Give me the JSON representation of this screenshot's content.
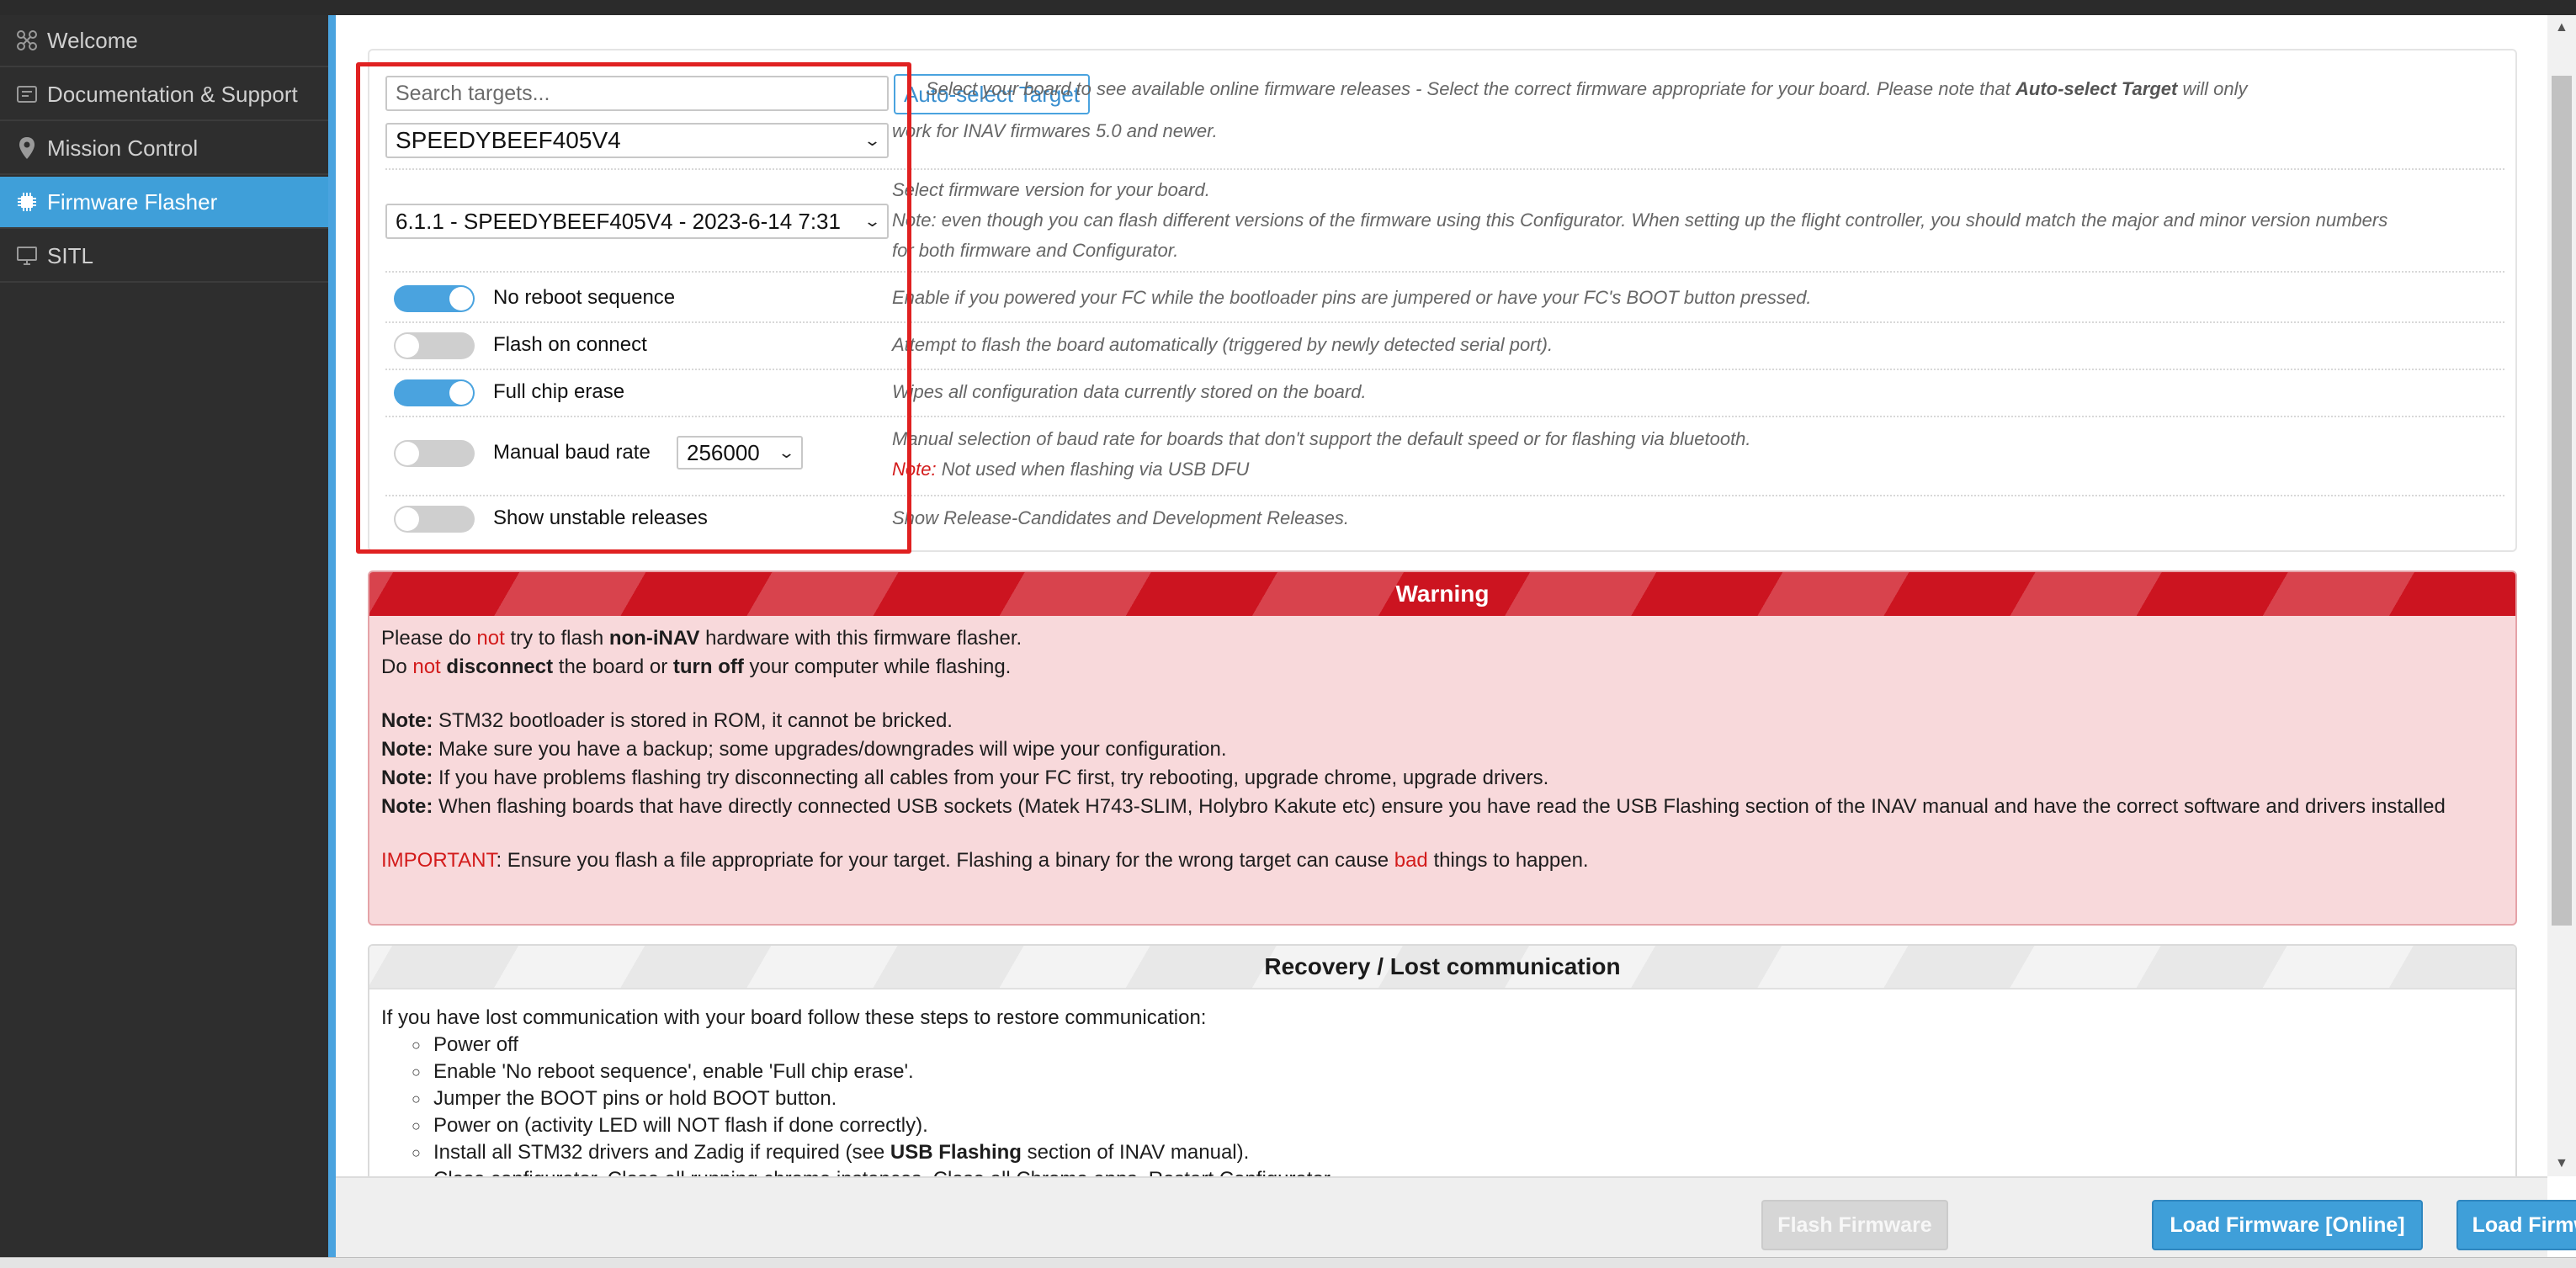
{
  "sidebar": {
    "items": [
      {
        "label": "Welcome",
        "icon": "welcome-icon"
      },
      {
        "label": "Documentation & Support",
        "icon": "support-icon"
      },
      {
        "label": "Mission Control",
        "icon": "map-pin-icon"
      },
      {
        "label": "Firmware Flasher",
        "icon": "chip-icon",
        "active": true
      },
      {
        "label": "SITL",
        "icon": "monitor-icon"
      }
    ]
  },
  "options": {
    "search_placeholder": "Search targets...",
    "autoselect_label": "Auto-select Target",
    "board_value": "SPEEDYBEEF405V4",
    "version_value": "6.1.1 - SPEEDYBEEF405V4 - 2023-6-14 7:31",
    "board_desc_1": "Select your board to see available online firmware releases - Select the correct firmware appropriate for your board. Please note that",
    "board_desc_bold": "Auto-select Target",
    "board_desc_2": "will only",
    "board_desc_line2": "work for INAV firmwares 5.0 and newer.",
    "version_desc_1": "Select firmware version for your board.",
    "version_desc_2": "Note: even though you can flash different versions of the firmware using this Configurator. When setting up the flight controller, you should match the major and minor version numbers",
    "version_desc_3": "for both firmware and Configurator.",
    "no_reboot_label": "No reboot sequence",
    "no_reboot_desc": "Enable if you powered your FC while the bootloader pins are jumpered or have your FC's BOOT button pressed.",
    "flash_connect_label": "Flash on connect",
    "flash_connect_desc": "Attempt to flash the board automatically (triggered by newly detected serial port).",
    "full_erase_label": "Full chip erase",
    "full_erase_desc": "Wipes all configuration data currently stored on the board.",
    "baud_label": "Manual baud rate",
    "baud_value": "256000",
    "baud_desc_1": "Manual selection of baud rate for boards that don't support the default speed or for flashing via bluetooth.",
    "baud_note_prefix": "Note:",
    "baud_note": "Not used when flashing via USB DFU",
    "unstable_label": "Show unstable releases",
    "unstable_desc": "Show Release-Candidates and Development Releases.",
    "toggles": {
      "no_reboot": true,
      "flash_connect": false,
      "full_erase": true,
      "baud": false,
      "unstable": false
    }
  },
  "warning": {
    "title": "Warning",
    "l1_a": "Please do",
    "l1_red": "not",
    "l1_b": "try to flash",
    "l1_bold": "non-iNAV",
    "l1_c": "hardware with this firmware flasher.",
    "l2_a": "Do",
    "l2_red": "not",
    "l2_bold1": "disconnect",
    "l2_b": "the board or",
    "l2_bold2": "turn off",
    "l2_c": "your computer while flashing.",
    "note_label": "Note:",
    "note1": "STM32 bootloader is stored in ROM, it cannot be bricked.",
    "note2": "Make sure you have a backup; some upgrades/downgrades will wipe your configuration.",
    "note3": "If you have problems flashing try disconnecting all cables from your FC first, try rebooting, upgrade chrome, upgrade drivers.",
    "note4": "When flashing boards that have directly connected USB sockets (Matek H743-SLIM, Holybro Kakute etc) ensure you have read the USB Flashing section of the INAV manual and have the correct software and drivers installed",
    "important_label": "IMPORTANT",
    "important_a": ": Ensure you flash a file appropriate for your target. Flashing a binary for the wrong target can cause",
    "important_red": "bad",
    "important_b": "things to happen."
  },
  "recovery": {
    "title": "Recovery / Lost communication",
    "intro": "If you have lost communication with your board follow these steps to restore communication:",
    "steps": [
      "Power off",
      "Enable 'No reboot sequence', enable 'Full chip erase'.",
      "Jumper the BOOT pins or hold BOOT button.",
      "Power on (activity LED will NOT flash if done correctly).",
      "Close configurator, Close all running chrome instances, Close all Chrome apps, Restart Configurator."
    ],
    "step5_a": "Install all STM32 drivers and Zadig if required (see",
    "step5_bold": "USB Flashing",
    "step5_b": "section of INAV manual)."
  },
  "toolbar": {
    "flash_label": "Flash Firmware",
    "load_online_label": "Load Firmware [Online]",
    "load_local_label": "Load Firmware [Local]"
  },
  "colors": {
    "accent": "#3f9fd9",
    "warning_red": "#cc1420",
    "highlight": "#e02121"
  }
}
